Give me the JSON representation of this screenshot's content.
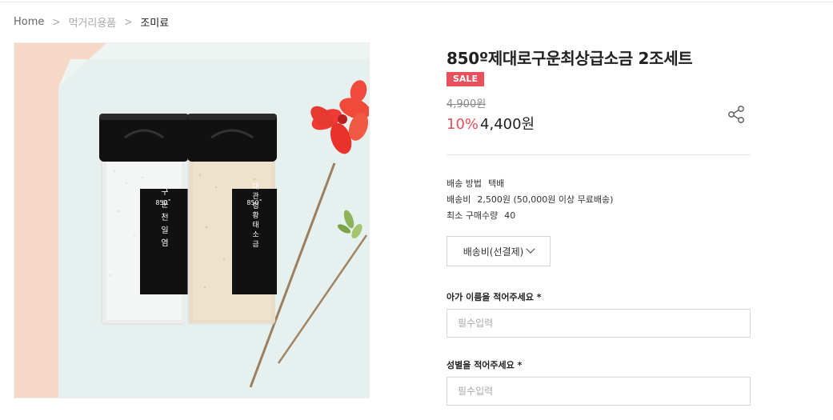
{
  "breadcrumb": {
    "home": "Home",
    "category": "먹거리용품",
    "current": "조미료"
  },
  "product": {
    "title": "850º제대로구운최상급소금 2조세트",
    "badge": "SALE",
    "original_price": "4,900원",
    "discount": "10%",
    "price": "4,400원",
    "image_labels": {
      "left_jar_brand": "850˚",
      "left_jar_name": "구운천일염",
      "right_jar_brand": "850˚",
      "right_jar_name": "대관령황태소금"
    }
  },
  "shipping": {
    "method_label": "배송 방법",
    "method_value": "택배",
    "fee_label": "배송비",
    "fee_value": "2,500원 (50,000원 이상 무료배송)",
    "min_qty_label": "최소 구매수량",
    "min_qty_value": "40",
    "option_select": "배송비(선결제)"
  },
  "options": {
    "name_label": "아가 이름을 적어주세요 *",
    "name_placeholder": "필수입력",
    "gender_label": "성별을 적어주세요 *",
    "gender_placeholder": "필수입력"
  },
  "colors": {
    "sale": "#e8505b",
    "background_peach": "#f6d8c6",
    "tile": "#e6f0ee"
  },
  "icons": {
    "share": "share-icon",
    "chevron": "chevron-down-icon",
    "breadcrumb_separator": "chevron-right-icon"
  }
}
